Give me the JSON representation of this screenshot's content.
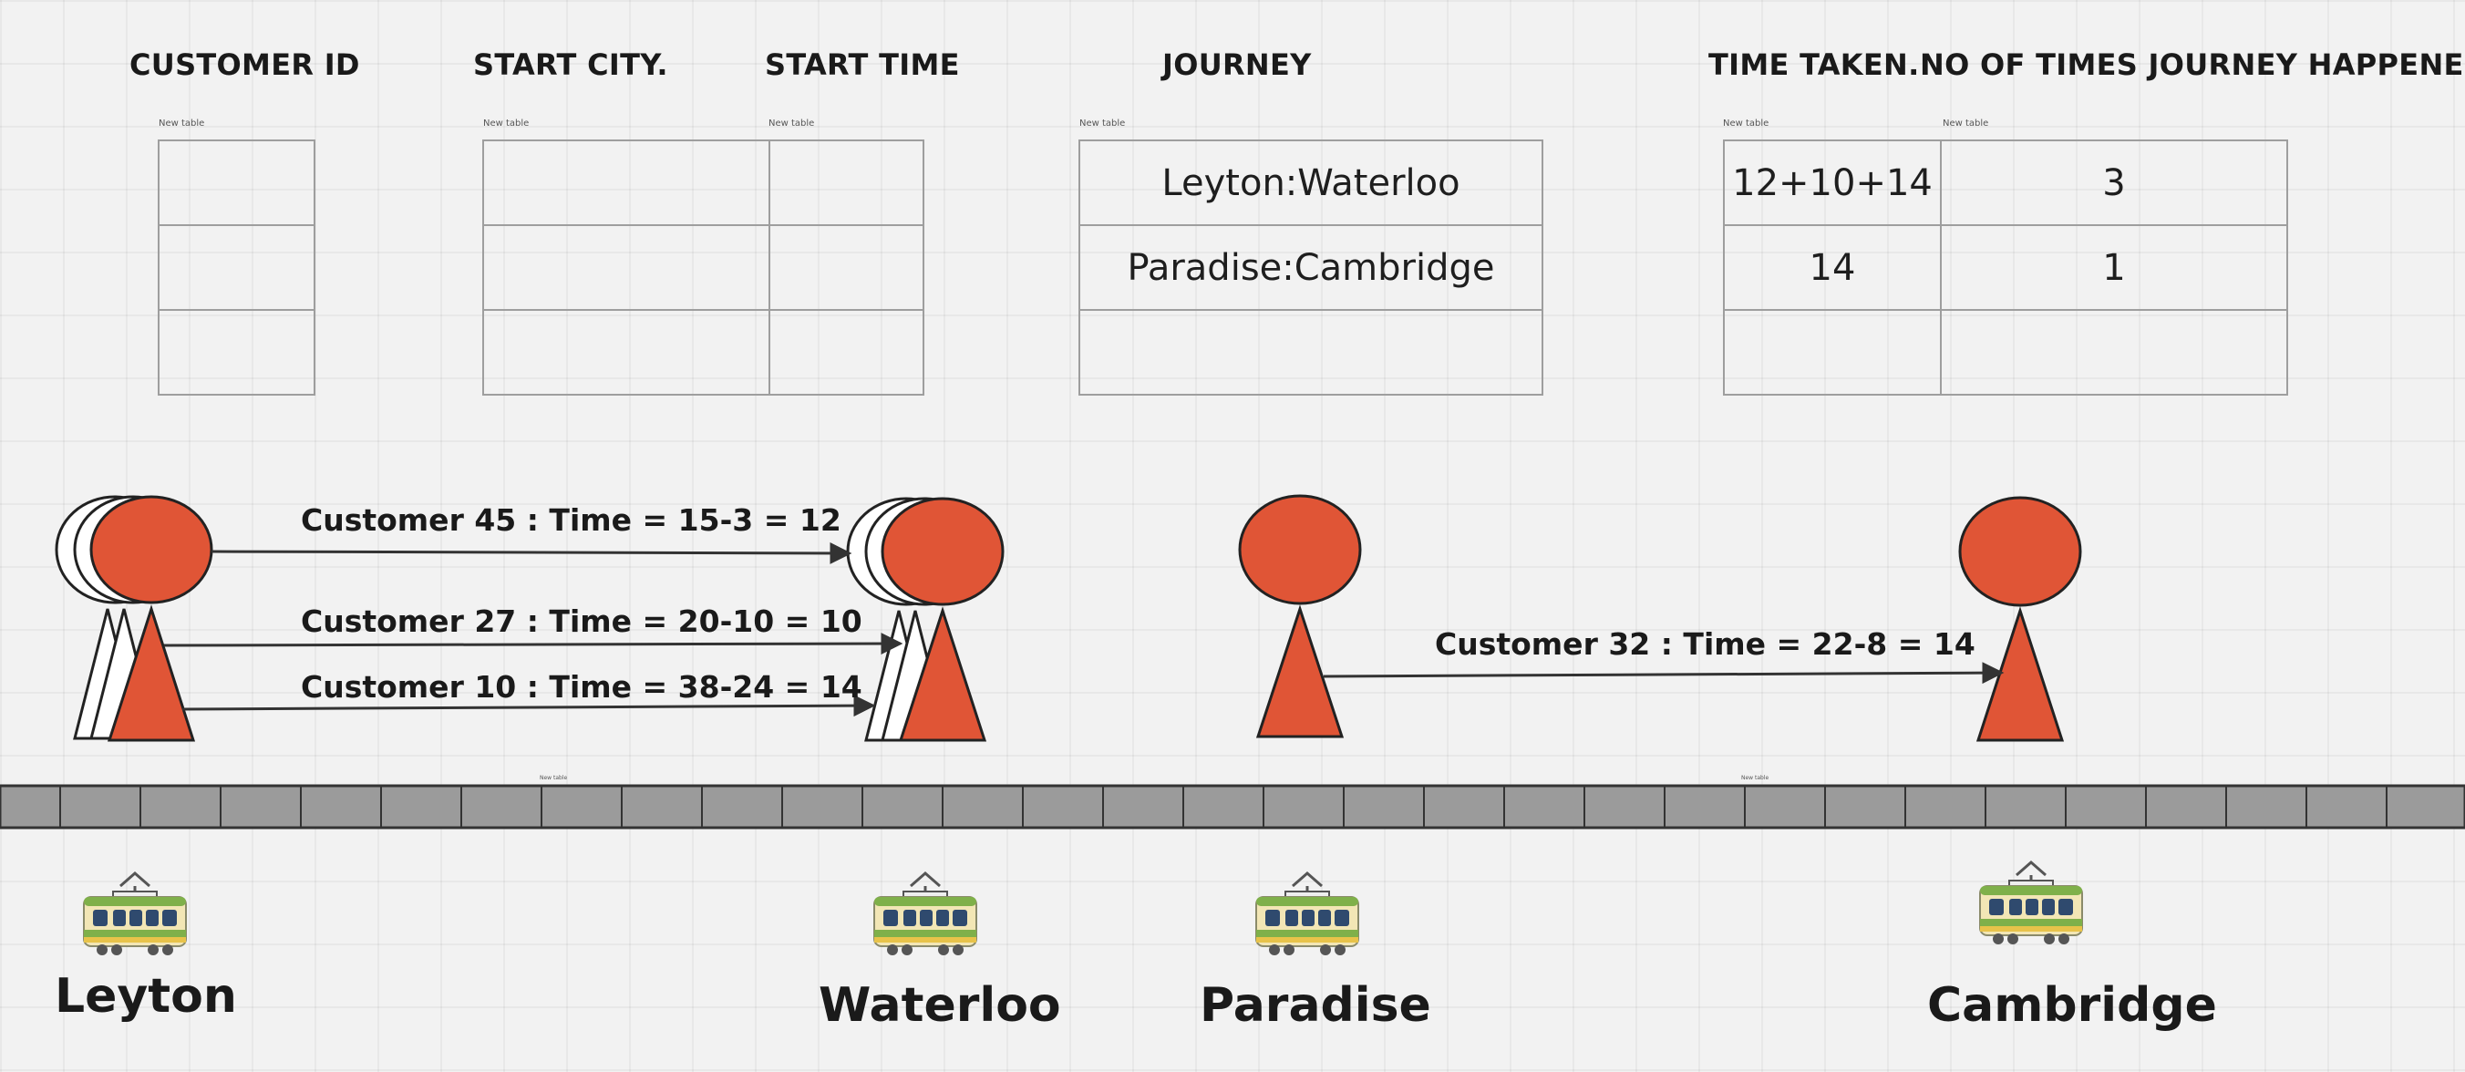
{
  "headers": {
    "customer_id": "CUSTOMER ID",
    "start_city": "START CITY.",
    "start_time": "START TIME",
    "journey": "JOURNEY",
    "time_taken": "TIME TAKEN.",
    "no_of_times": "NO OF TIMES JOURNEY HAPPENED"
  },
  "table_tag": "New table",
  "journey_table": {
    "rows": [
      "Leyton:Waterloo",
      "Paradise:Cambridge",
      ""
    ]
  },
  "stats_table": {
    "rows": [
      {
        "time_taken": "12+10+14",
        "count": "3"
      },
      {
        "time_taken": "14",
        "count": "1"
      },
      {
        "time_taken": "",
        "count": ""
      }
    ]
  },
  "arrows": [
    {
      "label": "Customer 45 : Time = 15-3 = 12",
      "from": "Leyton",
      "to": "Waterloo"
    },
    {
      "label": "Customer 27 : Time = 20-10 = 10",
      "from": "Leyton",
      "to": "Waterloo"
    },
    {
      "label": "Customer 10 : Time = 38-24 = 14",
      "from": "Leyton",
      "to": "Waterloo"
    },
    {
      "label": "Customer 32 : Time = 22-8 = 14",
      "from": "Paradise",
      "to": "Cambridge"
    }
  ],
  "cities": [
    "Leyton",
    "Waterloo",
    "Paradise",
    "Cambridge"
  ],
  "icons": {
    "station": "tram-icon",
    "passenger": "person-icon"
  },
  "colors": {
    "person_fill": "#e05536",
    "track_fill": "#9b9b9b",
    "table_border": "#9e9e9e",
    "background": "#f2f2f2"
  }
}
